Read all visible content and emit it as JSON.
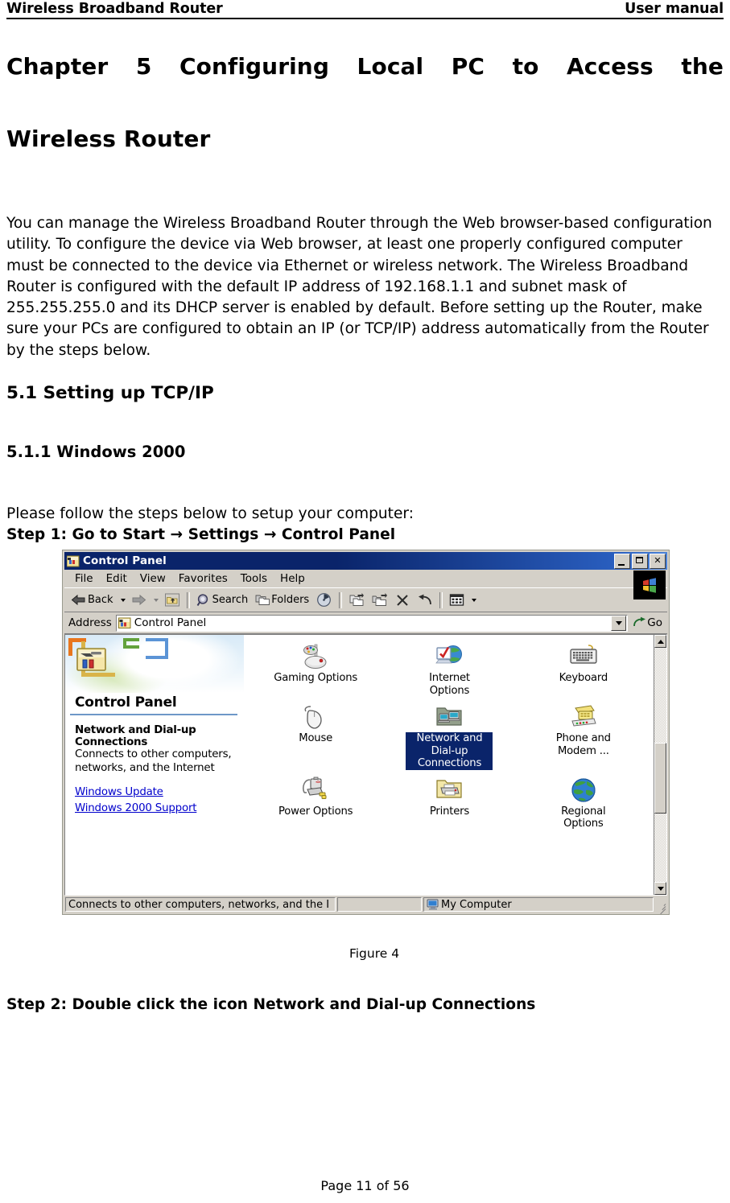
{
  "header": {
    "left": "Wireless Broadband Router",
    "right": "User manual"
  },
  "chapter": {
    "line1": "Chapter 5 Configuring Local PC to Access the",
    "line2": "Wireless Router"
  },
  "intro_paragraph": "You can manage the Wireless Broadband Router through the Web browser-based configuration utility. To configure the device via Web browser, at least one properly configured computer must be connected to the device via Ethernet or wireless network. The Wireless Broadband Router is configured with the default IP address of 192.168.1.1 and subnet mask of 255.255.255.0 and its DHCP server is enabled by default. Before setting up the Router, make sure your PCs are configured to obtain an IP (or TCP/IP) address automatically from the Router by the steps below.",
  "sections": {
    "h2": "5.1 Setting up TCP/IP",
    "h3": "5.1.1 Windows 2000"
  },
  "lead_text": "Please follow the steps below to setup your computer:",
  "step1": "Step 1: Go to Start → Settings → Control Panel",
  "figure_caption": "Figure 4",
  "step2": "Step 2: Double click the icon Network and Dial-up Connections",
  "footer": "Page 11 of 56",
  "window": {
    "title": "Control Panel",
    "title_buttons": {
      "minimize": "",
      "maximize": "",
      "close": "✕"
    },
    "menus": [
      "File",
      "Edit",
      "View",
      "Favorites",
      "Tools",
      "Help"
    ],
    "toolbar": {
      "back": "Back",
      "forward": "",
      "up": "",
      "search": "Search",
      "folders": "Folders",
      "history": "",
      "move_to": "",
      "copy_to": "",
      "delete": "",
      "undo": "",
      "views": ""
    },
    "address": {
      "label": "Address",
      "value": "Control Panel",
      "go": "Go"
    },
    "left_pane": {
      "banner_title": "Control Panel",
      "item_heading": "Network and Dial-up Connections",
      "item_description_line1": "Connects to other computers,",
      "item_description_line2": "networks, and the Internet",
      "links": [
        "Windows Update",
        "Windows 2000 Support"
      ]
    },
    "icons": [
      {
        "label": "Gaming Options",
        "icon": "gamepad-joystick-icon",
        "selected": false
      },
      {
        "label": "Internet Options",
        "icon": "internet-globe-icon",
        "selected": false
      },
      {
        "label": "Keyboard",
        "icon": "keyboard-icon",
        "selected": false
      },
      {
        "label": "Mouse",
        "icon": "mouse-icon",
        "selected": false
      },
      {
        "label": "Network and Dial-up Connections",
        "icon": "network-folder-icon",
        "selected": true
      },
      {
        "label": "Phone and Modem ...",
        "icon": "phone-modem-icon",
        "selected": false
      },
      {
        "label": "Power Options",
        "icon": "power-battery-icon",
        "selected": false
      },
      {
        "label": "Printers",
        "icon": "printer-folder-icon",
        "selected": false
      },
      {
        "label": "Regional Options",
        "icon": "regional-globe-icon",
        "selected": false
      }
    ],
    "statusbar": {
      "pane1": "Connects to other computers, networks, and the I",
      "pane2": "",
      "pane3": "My Computer"
    }
  },
  "colors": {
    "titlebar_start": "#0a246a",
    "titlebar_end": "#4a82d8",
    "selection": "#0a246a",
    "chrome": "#d4d0c8",
    "link": "#0000cc",
    "rule": "#6e97c8"
  }
}
